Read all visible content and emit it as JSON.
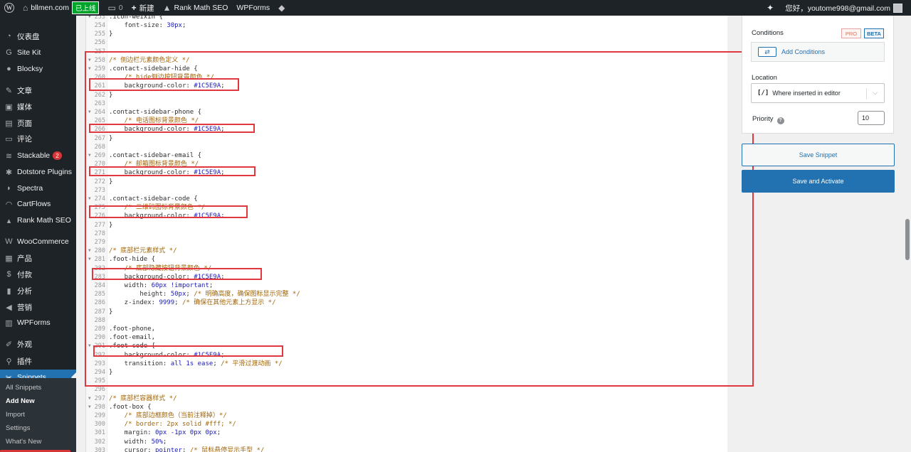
{
  "adminbar": {
    "site_name": "bllmen.com",
    "status_badge": "已上线",
    "comments_count": "0",
    "new_label": "新建",
    "rankmath_label": "Rank Math SEO",
    "wpforms_label": "WPForms",
    "greeting": "您好，youtome998@gmail.com"
  },
  "sidebar": {
    "items": [
      {
        "label": "仪表盘",
        "icon": "dashboard-icon"
      },
      {
        "label": "Site Kit",
        "icon": "sitekit-icon"
      },
      {
        "label": "Blocksy",
        "icon": "blocksy-icon"
      },
      {
        "label": "文章",
        "icon": "pin-icon"
      },
      {
        "label": "媒体",
        "icon": "media-icon"
      },
      {
        "label": "页面",
        "icon": "page-icon"
      },
      {
        "label": "评论",
        "icon": "comment-icon"
      },
      {
        "label": "Stackable",
        "icon": "stackable-icon",
        "badge": "2"
      },
      {
        "label": "Dotstore Plugins",
        "icon": "dotstore-icon"
      },
      {
        "label": "Spectra",
        "icon": "spectra-icon"
      },
      {
        "label": "CartFlows",
        "icon": "cartflows-icon"
      },
      {
        "label": "Rank Math SEO",
        "icon": "rankmath-icon"
      },
      {
        "label": "WooCommerce",
        "icon": "woocommerce-icon"
      },
      {
        "label": "产品",
        "icon": "product-icon"
      },
      {
        "label": "付款",
        "icon": "payment-icon"
      },
      {
        "label": "分析",
        "icon": "analytics-icon"
      },
      {
        "label": "营销",
        "icon": "megaphone-icon"
      },
      {
        "label": "WPForms",
        "icon": "wpforms-icon"
      },
      {
        "label": "外观",
        "icon": "appearance-icon"
      },
      {
        "label": "插件",
        "icon": "plugin-icon"
      },
      {
        "label": "Snippets",
        "icon": "scissors-icon"
      }
    ],
    "submenu": [
      "All Snippets",
      "Add New",
      "Import",
      "Settings",
      "What's New"
    ]
  },
  "editor": {
    "lines": [
      {
        "n": "253",
        "t": ".icon-weixin {",
        "k": "sel",
        "f": true
      },
      {
        "n": "254",
        "t": "    font-size: 30px;",
        "k": "decl",
        "p": "font-size",
        "v": "30px"
      },
      {
        "n": "255",
        "t": "}",
        "k": "sel"
      },
      {
        "n": "256",
        "t": "",
        "k": "sel"
      },
      {
        "n": "257",
        "t": "",
        "k": "sel"
      },
      {
        "n": "258",
        "t": "/* 侧边栏元素颜色定义 */",
        "k": "com",
        "f": true
      },
      {
        "n": "259",
        "t": ".contact-sidebar-hide {",
        "k": "sel",
        "f": true
      },
      {
        "n": "260",
        "t": "    /* hide侧边按钮背景颜色 */",
        "k": "com"
      },
      {
        "n": "261",
        "t": "    background-color: #1C5E9A;",
        "k": "decl",
        "p": "background-color",
        "v": "#1C5E9A"
      },
      {
        "n": "262",
        "t": "}",
        "k": "sel"
      },
      {
        "n": "263",
        "t": "",
        "k": "sel"
      },
      {
        "n": "264",
        "t": ".contact-sidebar-phone {",
        "k": "sel",
        "f": true
      },
      {
        "n": "265",
        "t": "    /* 电话图标背景颜色 */",
        "k": "com"
      },
      {
        "n": "266",
        "t": "    background-color: #1C5E9A;",
        "k": "decl",
        "p": "background-color",
        "v": "#1C5E9A"
      },
      {
        "n": "267",
        "t": "}",
        "k": "sel"
      },
      {
        "n": "268",
        "t": "",
        "k": "sel"
      },
      {
        "n": "269",
        "t": ".contact-sidebar-email {",
        "k": "sel",
        "f": true
      },
      {
        "n": "270",
        "t": "    /* 邮箱图标背景颜色 */",
        "k": "com"
      },
      {
        "n": "271",
        "t": "    background-color: #1C5E9A;",
        "k": "decl",
        "p": "background-color",
        "v": "#1C5E9A"
      },
      {
        "n": "272",
        "t": "}",
        "k": "sel"
      },
      {
        "n": "273",
        "t": "",
        "k": "sel"
      },
      {
        "n": "274",
        "t": ".contact-sidebar-code {",
        "k": "sel",
        "f": true
      },
      {
        "n": "275",
        "t": "    /* 二维码图标背景颜色 */",
        "k": "com"
      },
      {
        "n": "276",
        "t": "    background-color: #1C5E9A;",
        "k": "decl",
        "p": "background-color",
        "v": "#1C5E9A"
      },
      {
        "n": "277",
        "t": "}",
        "k": "sel"
      },
      {
        "n": "278",
        "t": "",
        "k": "sel"
      },
      {
        "n": "279",
        "t": "",
        "k": "sel"
      },
      {
        "n": "280",
        "t": "/* 底部栏元素样式 */",
        "k": "com",
        "f": true
      },
      {
        "n": "281",
        "t": ".foot-hide {",
        "k": "sel",
        "f": true
      },
      {
        "n": "282",
        "t": "    /* 底部隐藏按钮背景颜色 */",
        "k": "com"
      },
      {
        "n": "283",
        "t": "    background-color: #1C5E9A;",
        "k": "decl",
        "p": "background-color",
        "v": "#1C5E9A"
      },
      {
        "n": "284",
        "t": "    width: 60px !important;",
        "k": "decl",
        "p": "width",
        "v": "60px !important"
      },
      {
        "n": "285",
        "t": "        height: 50px; /* 明确高度，确保图标显示完整 */",
        "k": "mix",
        "p": "    height",
        "v": "50px",
        "c": "/* 明确高度，确保图标显示完整 */"
      },
      {
        "n": "286",
        "t": "    z-index: 9999; /* 确保在其他元素上方显示 */",
        "k": "mix",
        "p": "z-index",
        "v": "9999",
        "c": "/* 确保在其他元素上方显示 */"
      },
      {
        "n": "287",
        "t": "}",
        "k": "sel"
      },
      {
        "n": "288",
        "t": "",
        "k": "sel"
      },
      {
        "n": "289",
        "t": ".foot-phone,",
        "k": "sel"
      },
      {
        "n": "290",
        "t": ".foot-email,",
        "k": "sel"
      },
      {
        "n": "291",
        "t": ".foot-code {",
        "k": "sel",
        "f": true
      },
      {
        "n": "292",
        "t": "    background-color: #1C5E9A;",
        "k": "decl",
        "p": "background-color",
        "v": "#1C5E9A"
      },
      {
        "n": "293",
        "t": "    transition: all 1s ease; /* 平滑过渡动画 */",
        "k": "mix",
        "p": "transition",
        "v": "all 1s ease",
        "c": "/* 平滑过渡动画 */"
      },
      {
        "n": "294",
        "t": "}",
        "k": "sel"
      },
      {
        "n": "295",
        "t": "",
        "k": "sel"
      },
      {
        "n": "296",
        "t": "",
        "k": "sel"
      },
      {
        "n": "297",
        "t": "/* 底部栏容器样式 */",
        "k": "com",
        "f": true
      },
      {
        "n": "298",
        "t": ".foot-box {",
        "k": "sel",
        "f": true
      },
      {
        "n": "299",
        "t": "    /* 底部边框颜色（当前注释掉）*/",
        "k": "com"
      },
      {
        "n": "300",
        "t": "    /* border: 2px solid #fff; */",
        "k": "com"
      },
      {
        "n": "301",
        "t": "    margin: 0px -1px 0px 0px;",
        "k": "decl",
        "p": "margin",
        "v": "0px -1px 0px 0px"
      },
      {
        "n": "302",
        "t": "    width: 50%;",
        "k": "decl",
        "p": "width",
        "v": "50%"
      },
      {
        "n": "303",
        "t": "    cursor: pointer; /* 鼠标悬停显示手型 */",
        "k": "mix",
        "p": "cursor",
        "v": "pointer",
        "c": "/* 鼠标悬停显示手型 */"
      }
    ]
  },
  "panel": {
    "conditions_label": "Conditions",
    "pro_badge": "PRO",
    "beta_badge": "BETA",
    "add_conditions": "Add Conditions",
    "location_label": "Location",
    "location_value": "Where inserted in editor",
    "priority_label": "Priority",
    "priority_value": "10",
    "save_snippet": "Save Snippet",
    "save_activate": "Save and Activate"
  },
  "colors": {
    "highlight": "#e0383e",
    "admin_dark": "#1d2327",
    "accent": "#2271b1"
  }
}
